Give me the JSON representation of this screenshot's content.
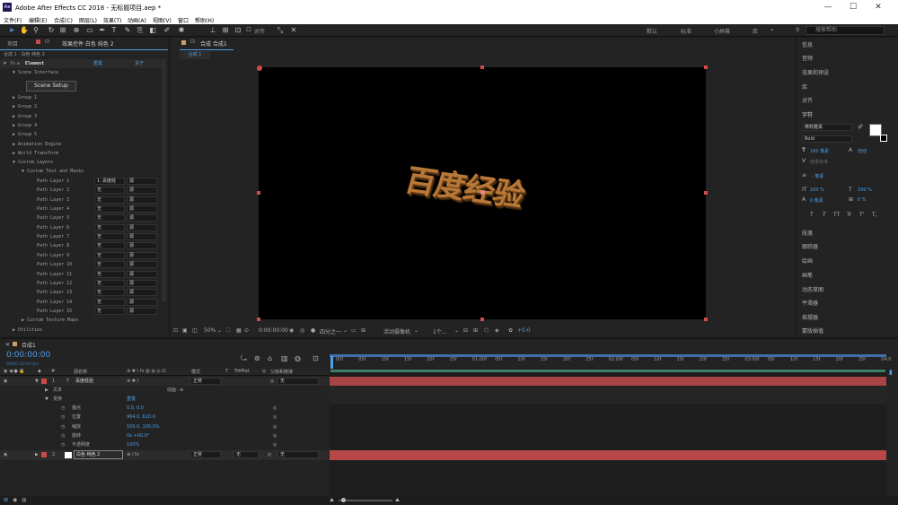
{
  "titlebar": {
    "logo": "Ae",
    "title": "Adobe After Effects CC 2018 - 无标题项目.aep *",
    "minimize": "—",
    "maximize": "☐",
    "close": "✕"
  },
  "menu": [
    "文件(F)",
    "编辑(E)",
    "合成(C)",
    "图层(L)",
    "效果(T)",
    "动画(A)",
    "视图(V)",
    "窗口",
    "帮助(H)"
  ],
  "toolbar": {
    "snap_label": "对齐",
    "workspaces": [
      "默认",
      "标准",
      "小屏幕",
      "库"
    ],
    "search_placeholder": "搜索帮助"
  },
  "left_panel": {
    "tab_project": "项目",
    "tab_effect": "效果控件 白色 纯色 2",
    "breadcrumb": "合成 1 · 白色 纯色 2",
    "effect_name": "Element",
    "reset": "重置",
    "about": "关于",
    "scene_interface": "Scene Interface",
    "scene_setup": "Scene Setup",
    "groups": [
      "Group 1",
      "Group 2",
      "Group 3",
      "Group 4",
      "Group 5"
    ],
    "sections": [
      "Animation Engine",
      "World Transform",
      "Custom Layers"
    ],
    "custom_text": "Custom Text and Masks",
    "path_layers": [
      {
        "name": "Path Layer 1",
        "val": "1.百度经",
        "mode": "源"
      },
      {
        "name": "Path Layer 2",
        "val": "无",
        "mode": "源"
      },
      {
        "name": "Path Layer 3",
        "val": "无",
        "mode": "源"
      },
      {
        "name": "Path Layer 4",
        "val": "无",
        "mode": "源"
      },
      {
        "name": "Path Layer 5",
        "val": "无",
        "mode": "源"
      },
      {
        "name": "Path Layer 6",
        "val": "无",
        "mode": "源"
      },
      {
        "name": "Path Layer 7",
        "val": "无",
        "mode": "源"
      },
      {
        "name": "Path Layer 8",
        "val": "无",
        "mode": "源"
      },
      {
        "name": "Path Layer 9",
        "val": "无",
        "mode": "源"
      },
      {
        "name": "Path Layer 10",
        "val": "无",
        "mode": "源"
      },
      {
        "name": "Path Layer 11",
        "val": "无",
        "mode": "源"
      },
      {
        "name": "Path Layer 12",
        "val": "无",
        "mode": "源"
      },
      {
        "name": "Path Layer 13",
        "val": "无",
        "mode": "源"
      },
      {
        "name": "Path Layer 14",
        "val": "无",
        "mode": "源"
      },
      {
        "name": "Path Layer 15",
        "val": "无",
        "mode": "源"
      }
    ],
    "texture_maps": "Custom Texture Maps",
    "utilities": "Utilities"
  },
  "comp_panel": {
    "tab": "合成 合成1",
    "breadcrumb": "合成 1",
    "canvas_text": "百度经验",
    "zoom": "50%",
    "timecode": "0:00:00:00",
    "resolution": "四分之一",
    "camera": "活动摄像机",
    "views": "1个...",
    "exposure": "+0.0"
  },
  "right_panel": {
    "items_top": [
      "信息",
      "音频",
      "效果和预设",
      "库",
      "对齐"
    ],
    "char_header": "字符",
    "font": "微软雅黑",
    "style": "Bold",
    "size": "160 像素",
    "leading": "自动",
    "tracking": "度量标准",
    "kerning": "- 像素",
    "vscale": "100 %",
    "hscale": "100 %",
    "baseline": "0 像素",
    "tsume": "0 %",
    "styles": [
      "T",
      "T",
      "TT",
      "Tr",
      "T'",
      "T,"
    ],
    "items_bottom": [
      "段落",
      "跟踪器",
      "绘画",
      "画笔",
      "动态草图",
      "平滑器",
      "摇摆器",
      "蒙版插值"
    ]
  },
  "timeline": {
    "tab": "合成1",
    "timecode": "0:00:00:00",
    "fps": "00000 (30.00 fps)",
    "col_hash": "#",
    "col_name": "源名称",
    "col_mode": "模式",
    "col_t": "T",
    "col_trkmat": "TrkMat",
    "col_parent": "父级和链接",
    "ruler_marks": [
      "00f",
      "05f",
      "10f",
      "15f",
      "20f",
      "25f",
      "01:00f",
      "05f",
      "10f",
      "15f",
      "20f",
      "25f",
      "02:00f",
      "05f",
      "10f",
      "15f",
      "20f",
      "25f",
      "03:00f",
      "05f",
      "10f",
      "15f",
      "20f",
      "25f",
      "04:0"
    ],
    "layer1": {
      "num": "1",
      "type": "T",
      "name": "百度经验",
      "mode": "正常",
      "parent": "无"
    },
    "text_prop": "文本",
    "anim_label": "动画：",
    "transform": "变换",
    "reset": "重置",
    "props": [
      {
        "name": "锚点",
        "val": "0.0, 0.0"
      },
      {
        "name": "位置",
        "val": "964.0, 610.0"
      },
      {
        "name": "缩放",
        "val": "100.0, 100.0%"
      },
      {
        "name": "旋转",
        "val": "0x +00.0°"
      },
      {
        "name": "不透明度",
        "val": "100%"
      }
    ],
    "layer2": {
      "num": "2",
      "name": "白色 纯色 2",
      "mode": "正常",
      "trkmat": "无",
      "parent": "无"
    }
  },
  "colors": {
    "accent": "#4f9fe8",
    "layer_red": "#c84a4a",
    "text_gold": "#b87838"
  }
}
